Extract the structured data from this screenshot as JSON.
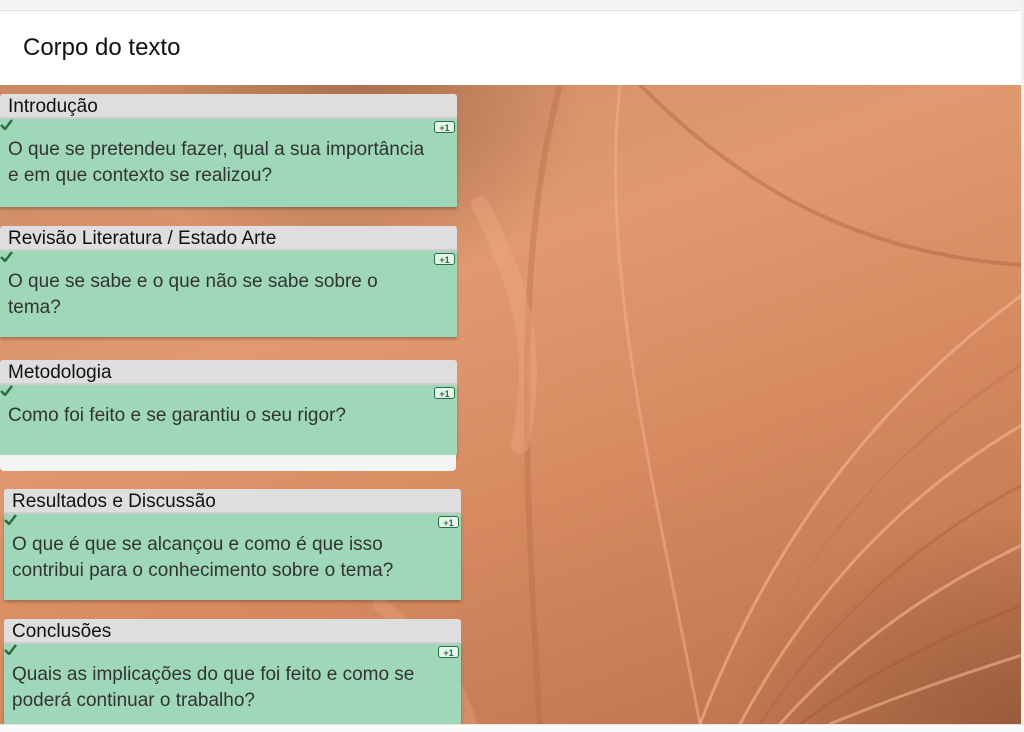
{
  "header": {
    "title": "Corpo do texto"
  },
  "cards": [
    {
      "label": "Introdução",
      "badge": "+1",
      "text": "O que se pretendeu fazer, qual a sua importância e em que contexto se realizou?"
    },
    {
      "label": "Revisão Literatura / Estado Arte",
      "badge": "+1",
      "text": "O que se sabe e o que não se sabe sobre o tema?"
    },
    {
      "label": "Metodologia",
      "badge": "+1",
      "text": "Como foi  feito e se garantiu o seu rigor?"
    },
    {
      "label": "Resultados e Discussão",
      "badge": "+1",
      "text": "O que é que se alcançou e como é que isso contribui para o conhecimento sobre o tema?"
    },
    {
      "label": "Conclusões",
      "badge": "+1",
      "text": "Quais as implicações do que foi feito e como se poderá continuar o trabalho?"
    }
  ],
  "icons": {
    "badge": "plus-one-icon",
    "check": "check-icon"
  },
  "colors": {
    "card_body": "#9fd8b9",
    "label_bar": "#dedede",
    "accent": "#2c6e44",
    "background": "#d78a60"
  }
}
